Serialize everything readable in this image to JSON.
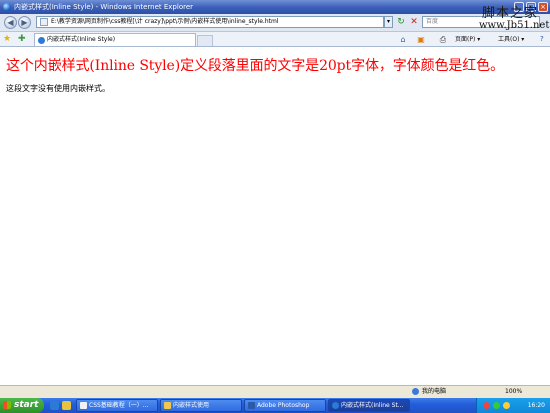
{
  "window": {
    "title": "内嵌式样式(Inline Style) - Windows Internet Explorer"
  },
  "watermark": {
    "line1": "脚本之家",
    "line2": "www.Jb51.net"
  },
  "address_bar": {
    "url": "E:\\教学资源\\网页制作\\css教程[\\计 crazy]\\ppt\\示例\\内嵌样式使用\\inline_style.html",
    "search_placeholder": "百度"
  },
  "tab": {
    "label": "内嵌式样式(Inline Style)"
  },
  "toolbar": {
    "page_label": "页面(P) ▾",
    "tools_label": "工具(O) ▾"
  },
  "content": {
    "heading": "这个内嵌样式(Inline Style)定义段落里面的文字是20pt字体，字体颜色是红色。",
    "heading_color": "#ff0000",
    "paragraph": "这段文字没有使用内嵌样式。"
  },
  "status_bar": {
    "zone": "我的电脑",
    "zoom": "100%"
  },
  "taskbar": {
    "start_label": "start",
    "tasks": [
      "CSS基础教程（一）...",
      "内嵌样式使用",
      "Adobe Photoshop",
      "内嵌式样式(Inline St..."
    ],
    "clock": "16:20"
  }
}
